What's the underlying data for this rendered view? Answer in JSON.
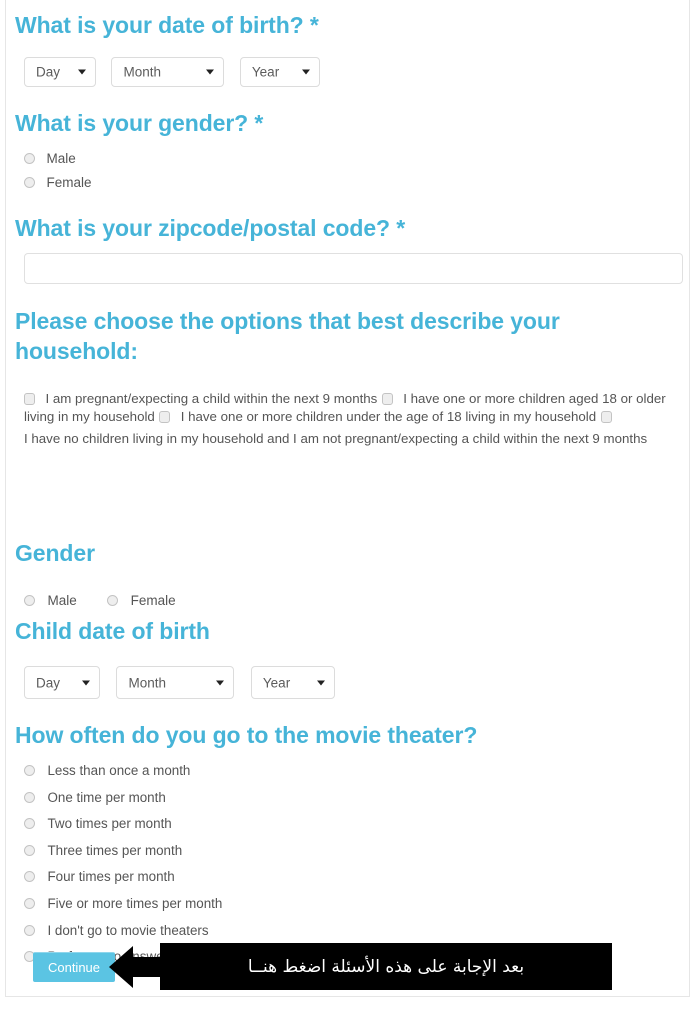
{
  "survey": {
    "questions": {
      "dob": {
        "heading": "What is your date of birth? *",
        "selects": [
          {
            "name": "day",
            "value": "Day"
          },
          {
            "name": "month",
            "value": "Month"
          },
          {
            "name": "year",
            "value": "Year"
          }
        ]
      },
      "gender": {
        "heading": "What is your gender? *",
        "options": [
          "Male",
          "Female"
        ]
      },
      "zipcode": {
        "heading": "What is your zipcode/postal code? *",
        "value": "",
        "placeholder": ""
      },
      "household": {
        "heading": "Please choose the options that best describe your household:",
        "options": [
          "I am pregnant/expecting a child within the next 9 months",
          "I have one or more children aged 18 or older living in my household",
          "I have one or more children under the age of 18 living in my household",
          "I have no children living in my household and I am not pregnant/expecting a child within the next 9 months"
        ]
      },
      "child_gender": {
        "heading": "Gender",
        "options": [
          "Male",
          "Female"
        ]
      },
      "child_dob": {
        "heading": "Child date of birth",
        "selects": [
          {
            "name": "day",
            "value": "Day"
          },
          {
            "name": "month",
            "value": "Month"
          },
          {
            "name": "year",
            "value": "Year"
          }
        ]
      },
      "movie_frequency": {
        "heading": "How often do you go to the movie theater?",
        "options": [
          "Less than once a month",
          "One time per month",
          "Two times per month",
          "Three times per month",
          "Four times per month",
          "Five or more times per month",
          "I don't go to movie theaters",
          "Prefer not to answer"
        ]
      }
    },
    "footer": {
      "continue_label": "Continue",
      "annotation_arrow": "left-arrow-icon",
      "annotation_text": "بعد الإجابة على هذه الأسئلة اضغط هنــا"
    },
    "colors": {
      "heading": "#46b4d8",
      "button": "#5bc4e3",
      "banner_background": "#000000",
      "banner_text": "#ffffff",
      "label_text": "#555555",
      "border": "#e0e0e0"
    }
  }
}
